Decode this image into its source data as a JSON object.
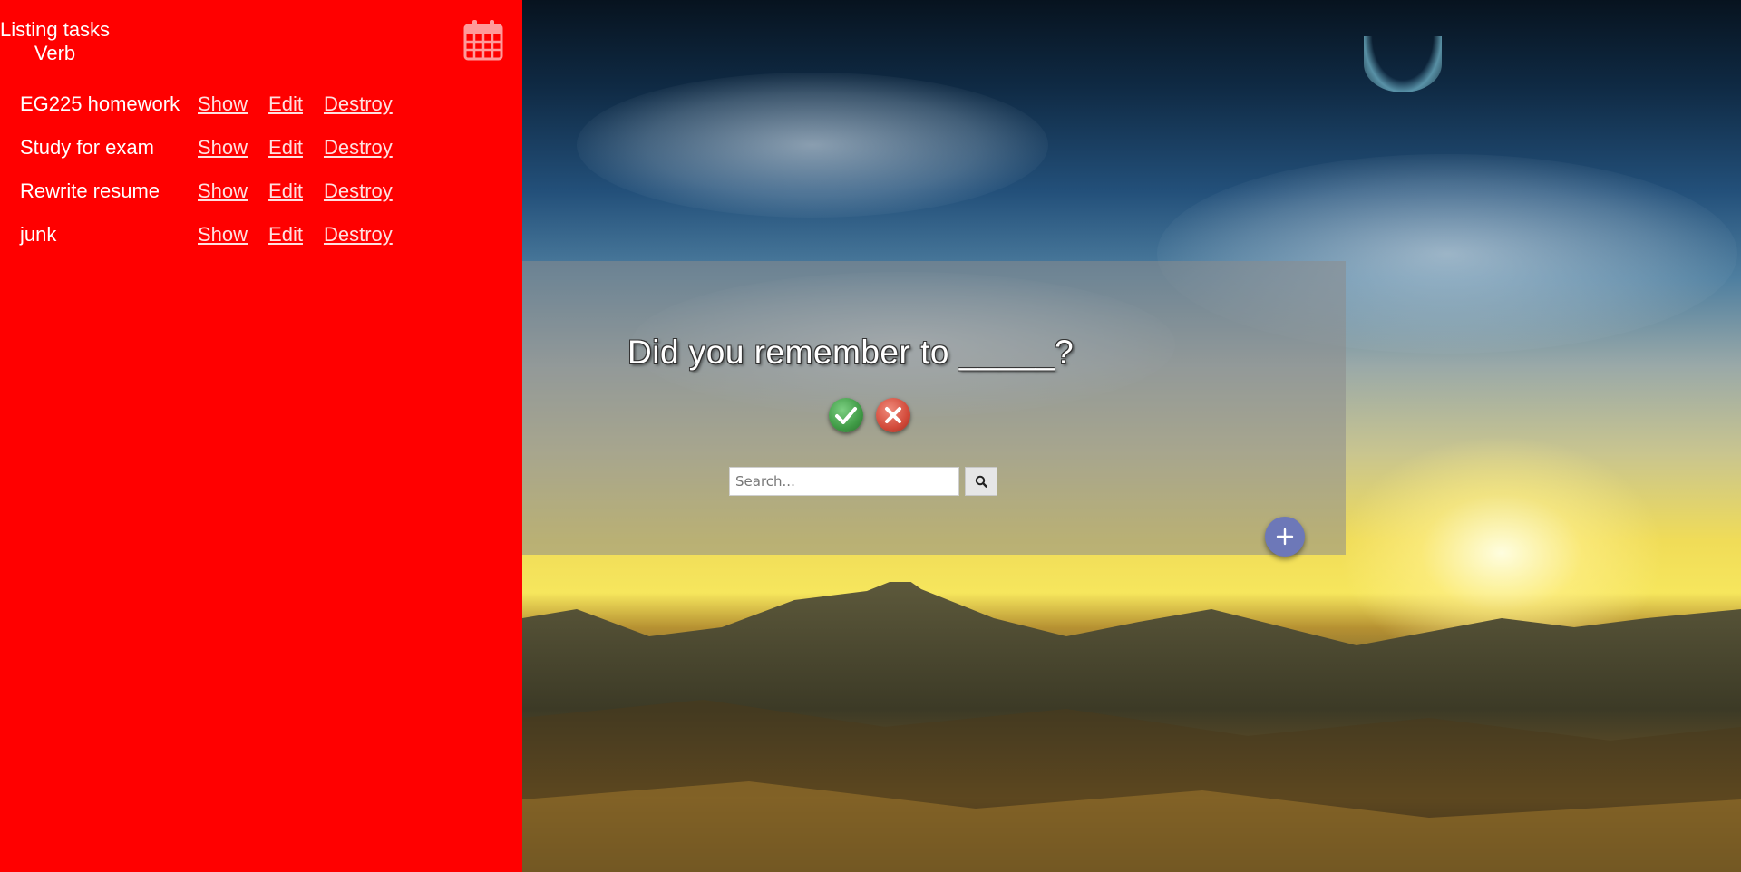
{
  "sidebar": {
    "title_line1": "Listing tasks",
    "title_line2": "Verb",
    "calendar_icon": "calendar-icon",
    "background_color": "#ff0000",
    "tasks": [
      {
        "name": "EG225 homework",
        "show": "Show",
        "edit": "Edit",
        "destroy": "Destroy"
      },
      {
        "name": "Study for exam",
        "show": "Show",
        "edit": "Edit",
        "destroy": "Destroy"
      },
      {
        "name": "Rewrite resume",
        "show": "Show",
        "edit": "Edit",
        "destroy": "Destroy"
      },
      {
        "name": "junk",
        "show": "Show",
        "edit": "Edit",
        "destroy": "Destroy"
      }
    ]
  },
  "main": {
    "prompt": "Did you remember to _____?",
    "yes_icon": "checkmark-icon",
    "no_icon": "close-icon",
    "search": {
      "placeholder": "Search...",
      "value": "",
      "button_icon": "search-icon"
    },
    "add_icon": "plus-icon",
    "add_color": "#6d78b8"
  }
}
